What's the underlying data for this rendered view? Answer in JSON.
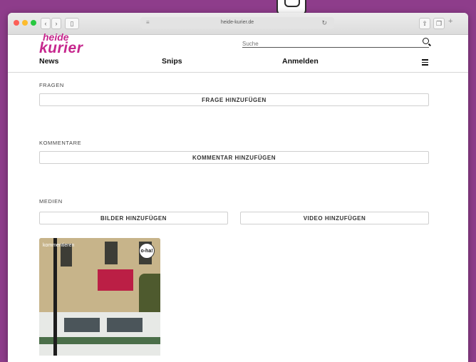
{
  "browser": {
    "url": "heide-kurier.de",
    "reader_icon": "reader-icon",
    "reload_icon": "reload-icon"
  },
  "site": {
    "logo_line1": "heide",
    "logo_line2": "kurier",
    "search_placeholder": "Suche",
    "brand_color": "#c6278d"
  },
  "nav": {
    "news": "News",
    "snips": "Snips",
    "login": "Anmelden",
    "menu_icon": "hamburger-menu-icon"
  },
  "sections": {
    "fragen": {
      "title": "FRAGEN",
      "button": "FRAGE HINZUFÜGEN"
    },
    "kommentare": {
      "title": "KOMMENTARE",
      "button": "KOMMENTAR HINZUFÜGEN"
    },
    "medien": {
      "title": "MEDIEN",
      "images_button": "BILDER HINZUFÜGEN",
      "video_button": "VIDEO HINZUFÜGEN"
    }
  },
  "media_item": {
    "caption": "kommentieren",
    "badge": "o-ha!"
  }
}
